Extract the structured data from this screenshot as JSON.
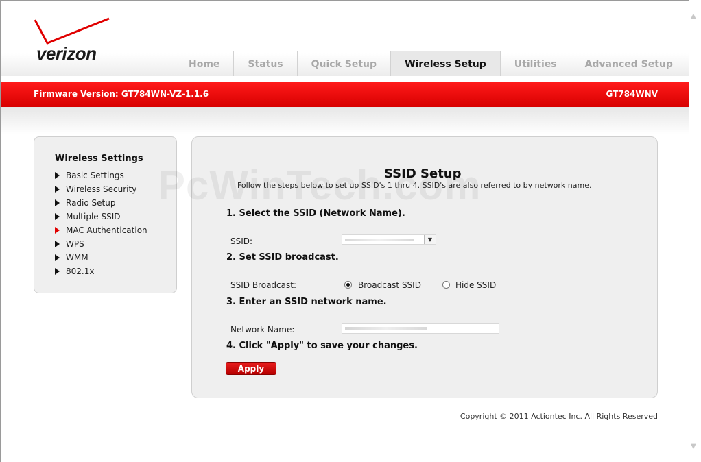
{
  "brand": {
    "logo_text": "verizon",
    "accent": "#e00000"
  },
  "nav": {
    "tabs": [
      {
        "label": "Home"
      },
      {
        "label": "Status"
      },
      {
        "label": "Quick Setup"
      },
      {
        "label": "Wireless Setup",
        "active": true
      },
      {
        "label": "Utilities"
      },
      {
        "label": "Advanced Setup"
      }
    ]
  },
  "banner": {
    "firmware": "Firmware Version: GT784WN-VZ-1.1.6",
    "model": "GT784WNV"
  },
  "sidebar": {
    "title": "Wireless Settings",
    "items": [
      {
        "label": "Basic Settings"
      },
      {
        "label": "Wireless Security"
      },
      {
        "label": "Radio Setup"
      },
      {
        "label": "Multiple SSID"
      },
      {
        "label": "MAC Authentication",
        "active": true
      },
      {
        "label": "WPS"
      },
      {
        "label": "WMM"
      },
      {
        "label": "802.1x"
      }
    ]
  },
  "main": {
    "watermark": "PcWinTech.com",
    "title": "SSID Setup",
    "description": "Follow the steps below to set up SSID's 1 thru 4. SSID's are also referred to by network name.",
    "step1": "1. Select the SSID (Network Name).",
    "ssid_label": "SSID:",
    "step2": "2. Set SSID broadcast.",
    "broadcast_label": "SSID Broadcast:",
    "broadcast_option": "Broadcast SSID",
    "hide_option": "Hide SSID",
    "step3": "3. Enter an SSID network name.",
    "network_name_label": "Network Name:",
    "step4": "4. Click \"Apply\" to save your changes.",
    "apply_label": "Apply"
  },
  "footer": {
    "copyright": "Copyright © 2011 Actiontec Inc. All Rights Reserved"
  }
}
